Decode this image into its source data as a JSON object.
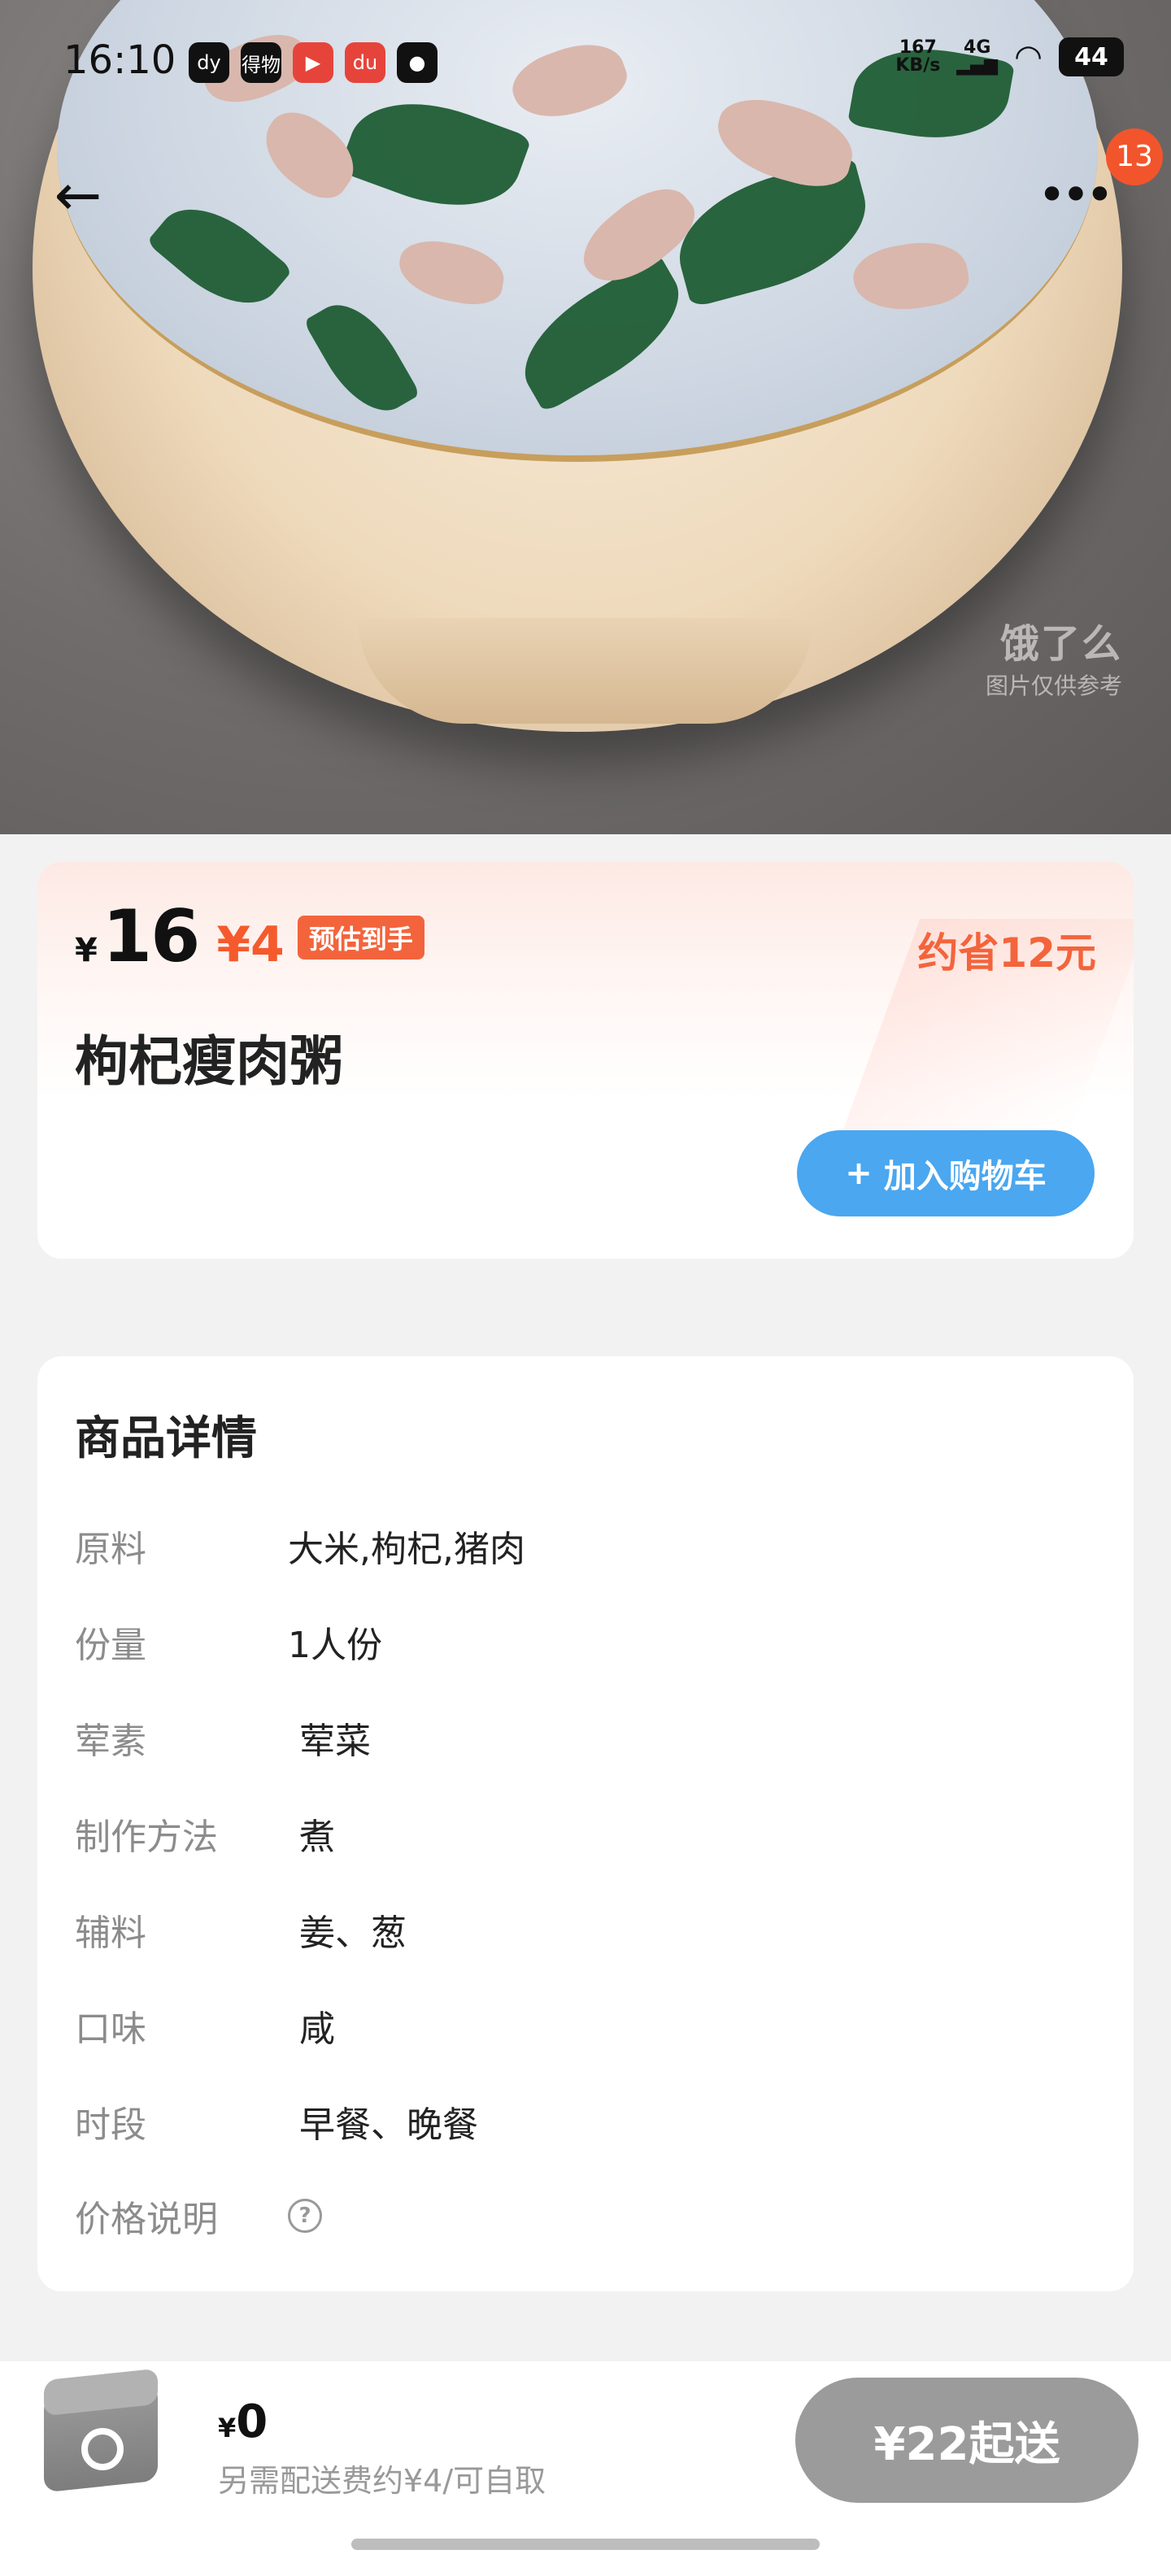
{
  "status_bar": {
    "time": "16:10",
    "apps": [
      "dy",
      "得物",
      "▶",
      "du",
      "●"
    ],
    "speed_value": "167",
    "speed_unit": "KB/s",
    "network": "4G",
    "battery": "44"
  },
  "header": {
    "back_icon": "arrow-left-icon",
    "more_icon": "more-dots-icon",
    "badge_count": "13"
  },
  "hero": {
    "watermark_brand": "饿了么",
    "watermark_note": "图片仅供参考"
  },
  "price": {
    "currency": "¥",
    "original": "16",
    "discount": "¥4",
    "discount_tag": "预估到手",
    "save_text": "约省12元"
  },
  "product": {
    "title": "枸杞瘦肉粥",
    "add_cart_label": "加入购物车",
    "add_cart_plus": "+"
  },
  "details": {
    "title": "商品详情",
    "rows": [
      {
        "key": "原料",
        "value": "大米,枸杞,猪肉"
      },
      {
        "key": "份量",
        "value": "1人份"
      },
      {
        "key": "荤素",
        "value": "荤菜"
      },
      {
        "key": "制作方法",
        "value": "煮"
      },
      {
        "key": "辅料",
        "value": "姜、葱"
      },
      {
        "key": "口味",
        "value": "咸"
      },
      {
        "key": "时段",
        "value": "早餐、晚餐"
      },
      {
        "key": "价格说明",
        "value": ""
      }
    ],
    "help_icon": "?"
  },
  "bottom_bar": {
    "cart_currency": "¥",
    "cart_amount": "0",
    "cart_note": "另需配送费约¥4/可自取",
    "checkout_label": "¥22起送"
  },
  "colors": {
    "accent_orange": "#f3643c",
    "button_blue": "#4aa7f0",
    "checkout_gray": "#9b9b9b"
  }
}
